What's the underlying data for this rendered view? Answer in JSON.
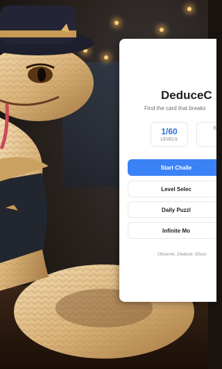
{
  "app": {
    "title": "DeduceC",
    "subtitle": "Find the card that breaks",
    "tagline": "Observe. Deduce. Disco"
  },
  "stats": [
    {
      "value": "1/60",
      "label": "LEVELS"
    },
    {
      "value": "",
      "label": "B"
    }
  ],
  "buttons": {
    "start": "Start Challe",
    "level_select": "Level Selec",
    "daily_puzzle": "Daily Puzzl",
    "infinite": "Infinite Mo"
  },
  "colors": {
    "primary": "#3b82f6",
    "stat_value": "#2c6fd6"
  }
}
